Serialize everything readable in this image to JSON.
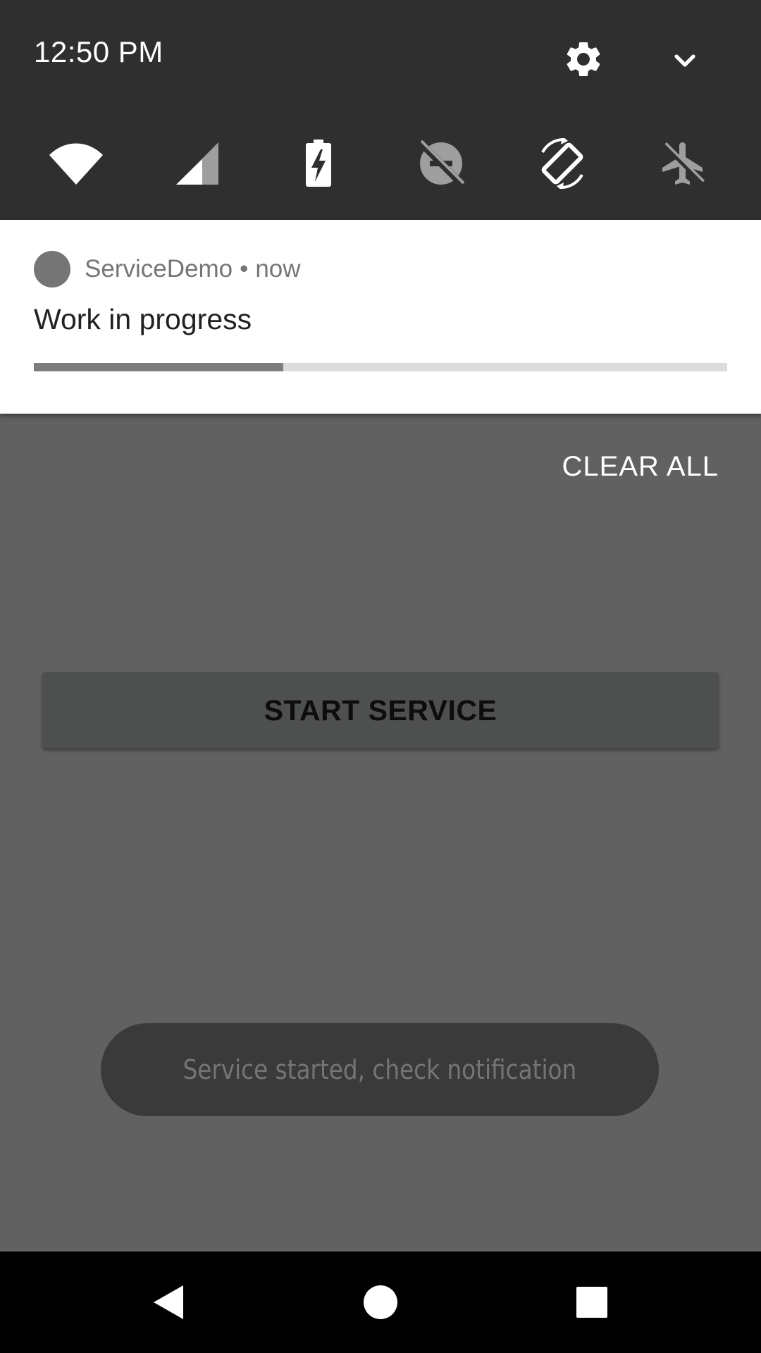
{
  "status": {
    "time": "12:50 PM"
  },
  "quick_settings": {
    "icons": {
      "settings": "gear-icon",
      "expand": "chevron-down-icon",
      "tiles": [
        "wifi-icon",
        "cellular-signal-icon",
        "battery-charging-icon",
        "do-not-disturb-off-icon",
        "auto-rotate-icon",
        "airplane-mode-icon"
      ]
    }
  },
  "notification": {
    "app_name": "ServiceDemo",
    "separator": "•",
    "time": "now",
    "title": "Work in progress",
    "progress_fraction": 0.36
  },
  "clear_all": "CLEAR ALL",
  "app": {
    "start_button": "START SERVICE"
  },
  "toast": {
    "message": "Service started, check notification"
  },
  "navigation": {
    "icons": [
      "back-icon",
      "home-icon",
      "recents-icon"
    ]
  },
  "colors": {
    "shade_background": "#2f2f2f",
    "scrim": "#616161",
    "progress_fill": "#7d7d7d",
    "progress_track": "#dcdcdc"
  }
}
